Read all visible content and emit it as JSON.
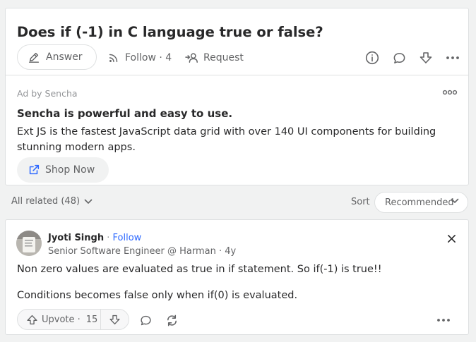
{
  "question": {
    "title": "Does if (-1) in C language true or false?",
    "answer_label": "Answer",
    "follow_label": "Follow · 4",
    "request_label": "Request"
  },
  "ad": {
    "label": "Ad by Sencha",
    "title": "Sencha is powerful and easy to use.",
    "body": "Ext JS is the fastest JavaScript data grid with over 140 UI components for building stunning modern apps.",
    "cta": "Shop Now"
  },
  "related": {
    "label": "All related (48)",
    "sort_label": "Sort",
    "sort_value": "Recommended"
  },
  "answer": {
    "author": "Jyoti Singh",
    "separator": "·",
    "follow": "Follow",
    "credential": "Senior Software Engineer @ Harman · 4y",
    "paragraphs": [
      "Non zero values are evaluated as true in if statement. So if(-1) is true!!",
      "Conditions becomes false only when if(0) is evaluated."
    ],
    "upvote_label": "Upvote ·",
    "upvote_count": "15"
  },
  "colors": {
    "accent_blue": "#2e69ff",
    "text_primary": "#282829",
    "text_secondary": "#636466",
    "border": "#dee0e1",
    "background": "#f1f2f2"
  },
  "icons": [
    "pencil-icon",
    "follow-signal-icon",
    "request-person-icon",
    "info-icon",
    "comment-icon",
    "downvote-icon",
    "more-icon",
    "external-link-icon",
    "chevron-down-icon",
    "close-icon",
    "upvote-icon",
    "share-icon"
  ]
}
